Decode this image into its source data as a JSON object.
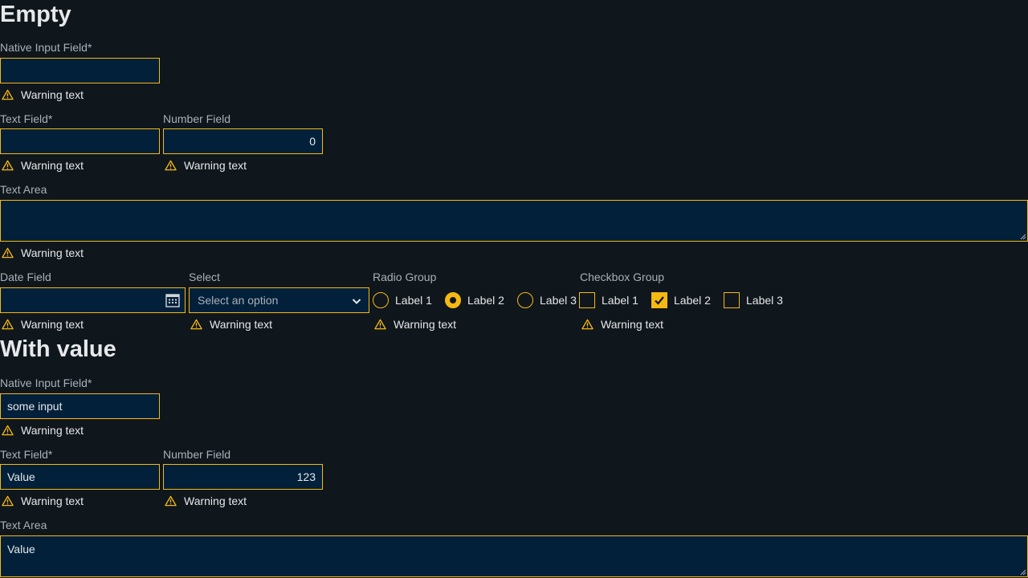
{
  "empty": {
    "heading": "Empty",
    "native_input": {
      "label": "Native Input Field*",
      "value": "",
      "warning": "Warning text"
    },
    "text_field": {
      "label": "Text Field*",
      "value": "",
      "warning": "Warning text"
    },
    "number_field": {
      "label": "Number Field",
      "value": "0",
      "warning": "Warning text"
    },
    "text_area": {
      "label": "Text Area",
      "value": "",
      "warning": "Warning text"
    },
    "date_field": {
      "label": "Date Field",
      "value": "",
      "warning": "Warning text"
    },
    "select": {
      "label": "Select",
      "placeholder": "Select an option",
      "warning": "Warning text"
    },
    "radio_group": {
      "label": "Radio Group",
      "options": [
        "Label 1",
        "Label 2",
        "Label 3"
      ],
      "selected": "Label 2",
      "warning": "Warning text"
    },
    "checkbox_group": {
      "label": "Checkbox Group",
      "options": [
        "Label 1",
        "Label 2",
        "Label 3"
      ],
      "checked": [
        "Label 2"
      ],
      "warning": "Warning text"
    }
  },
  "with_value": {
    "heading": "With value",
    "native_input": {
      "label": "Native Input Field*",
      "value": "some input",
      "warning": "Warning text"
    },
    "text_field": {
      "label": "Text Field*",
      "value": "Value",
      "warning": "Warning text"
    },
    "number_field": {
      "label": "Number Field",
      "value": "123",
      "warning": "Warning text"
    },
    "text_area": {
      "label": "Text Area",
      "value": "Value"
    }
  },
  "icons": {
    "warning": "warning-triangle-icon",
    "calendar": "calendar-icon",
    "chevron": "chevron-down-icon",
    "check": "checkmark-icon"
  },
  "colors": {
    "background": "#0f161c",
    "field_background": "#03203a",
    "warning_accent": "#f5b912",
    "label_text": "#a9b1b8",
    "text": "#e6e8ea"
  }
}
